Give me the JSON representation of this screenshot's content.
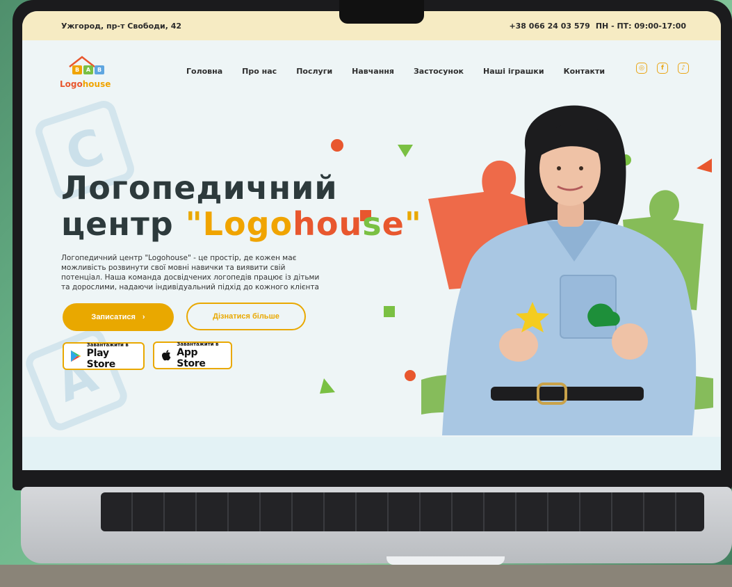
{
  "topbar": {
    "address": "Ужгород, пр-т Свободи, 42",
    "phone": "+38 066 24 03 579",
    "hours": "ПН - ПТ: 09:00-17:00"
  },
  "logo": {
    "blocks": [
      "B",
      "A",
      "B"
    ],
    "text_part1": "Logo",
    "text_part2": "house"
  },
  "nav": {
    "items": [
      "Головна",
      "Про нас",
      "Послуги",
      "Навчання",
      "Застосунок",
      "Наші іграшки",
      "Контакти"
    ]
  },
  "social": {
    "icons": [
      "instagram-icon",
      "facebook-icon",
      "tiktok-icon"
    ]
  },
  "hero": {
    "title_line1": "Логопедичний",
    "title_line2": "центр",
    "brand_quote_open": "\"",
    "brand_letters": [
      "L",
      "o",
      "g",
      "o",
      "h",
      "o",
      "u",
      "s",
      "e"
    ],
    "brand_colors": [
      "#f0a400",
      "#f0a400",
      "#f0a400",
      "#f0a400",
      "#e8572e",
      "#e8572e",
      "#e8572e",
      "#7ac043",
      "#e8572e"
    ],
    "brand_quote_close": "\"",
    "description": "Логопедичний центр \"Logohouse\" - це простір, де кожен має можливість розвинути свої мовні навички та виявити свій потенціал. Наша команда досвідчених логопедів працює із дітьми та дорослими, надаючи індивідуальний підхід до кожного клієнта",
    "primary_button": "Записатися",
    "primary_button_arrow": "›",
    "secondary_button": "Дізнатися більше"
  },
  "stores": {
    "play": {
      "small": "Завантажити в",
      "big": "Play Store"
    },
    "app": {
      "small": "Завантажити в",
      "big": "App Store"
    }
  },
  "colors": {
    "accent": "#e9a800",
    "orange": "#e8572e",
    "green": "#7ac043",
    "topbar_bg": "#f6ebc3"
  }
}
